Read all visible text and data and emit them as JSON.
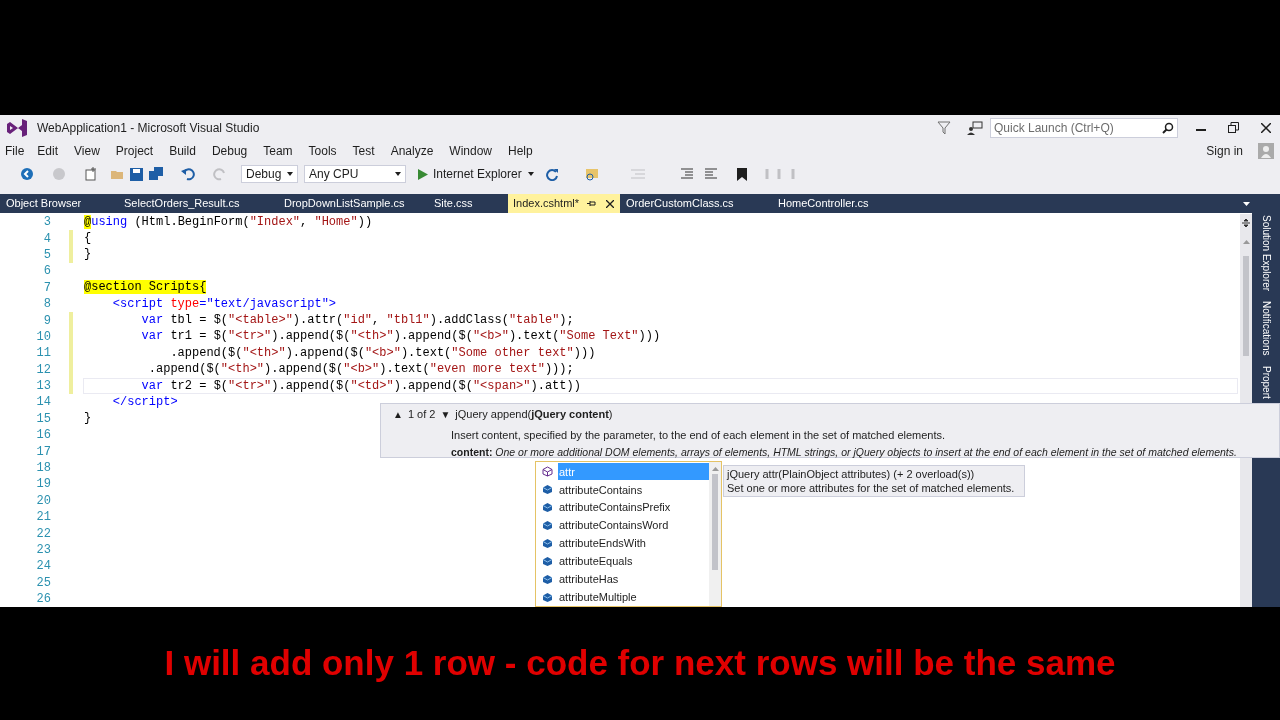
{
  "window": {
    "title": "WebApplication1 - Microsoft Visual Studio"
  },
  "quick_launch": {
    "placeholder": "Quick Launch (Ctrl+Q)"
  },
  "menu": [
    "File",
    "Edit",
    "View",
    "Project",
    "Build",
    "Debug",
    "Team",
    "Tools",
    "Test",
    "Analyze",
    "Window",
    "Help"
  ],
  "sign_in": "Sign in",
  "toolbar": {
    "configuration": "Debug",
    "platform": "Any CPU",
    "run_target": "Internet Explorer"
  },
  "tabs": [
    {
      "label": "Object Browser",
      "selected": false
    },
    {
      "label": "SelectOrders_Result.cs",
      "selected": false
    },
    {
      "label": "DropDownListSample.cs",
      "selected": false
    },
    {
      "label": "Site.css",
      "selected": false
    },
    {
      "label": "Index.cshtml*",
      "selected": true
    },
    {
      "label": "OrderCustomClass.cs",
      "selected": false
    },
    {
      "label": "HomeController.cs",
      "selected": false
    }
  ],
  "side_panels": [
    "Solution Explorer",
    "Notifications",
    "Propert"
  ],
  "code_lines": [
    {
      "number": "3",
      "changed": false,
      "current": false,
      "tokens": [
        {
          "kind": "razor",
          "text": "@"
        },
        {
          "kind": "keyword",
          "text": "using"
        },
        {
          "kind": "plain",
          "text": " (Html.BeginForm("
        },
        {
          "kind": "string",
          "text": "\"Index\""
        },
        {
          "kind": "plain",
          "text": ", "
        },
        {
          "kind": "string",
          "text": "\"Home\""
        },
        {
          "kind": "plain",
          "text": "))"
        }
      ]
    },
    {
      "number": "4",
      "changed": true,
      "current": false,
      "tokens": [
        {
          "kind": "plain",
          "text": "{"
        }
      ]
    },
    {
      "number": "5",
      "changed": true,
      "current": false,
      "tokens": [
        {
          "kind": "plain",
          "text": "}"
        }
      ]
    },
    {
      "number": "6",
      "changed": false,
      "current": false
    },
    {
      "number": "7",
      "changed": false,
      "current": false,
      "tokens": [
        {
          "kind": "razor",
          "text": "@section Scripts{"
        }
      ]
    },
    {
      "number": "8",
      "changed": false,
      "current": false,
      "tokens": [
        {
          "kind": "tag",
          "text": "    <script"
        },
        {
          "kind": "attribute",
          "text": " type"
        },
        {
          "kind": "tag",
          "text": "=\"text/javascript\">"
        }
      ]
    },
    {
      "number": "9",
      "changed": true,
      "current": false,
      "tokens": [
        {
          "kind": "keyword",
          "text": "        var"
        },
        {
          "kind": "plain",
          "text": " tbl = $("
        },
        {
          "kind": "string",
          "text": "\"<table>\""
        },
        {
          "kind": "plain",
          "text": ").attr("
        },
        {
          "kind": "string",
          "text": "\"id\""
        },
        {
          "kind": "plain",
          "text": ", "
        },
        {
          "kind": "string",
          "text": "\"tbl1\""
        },
        {
          "kind": "plain",
          "text": ").addClass("
        },
        {
          "kind": "string",
          "text": "\"table\""
        },
        {
          "kind": "plain",
          "text": ");"
        }
      ]
    },
    {
      "number": "10",
      "changed": true,
      "current": false,
      "tokens": [
        {
          "kind": "keyword",
          "text": "        var"
        },
        {
          "kind": "plain",
          "text": " tr1 = $("
        },
        {
          "kind": "string",
          "text": "\"<tr>\""
        },
        {
          "kind": "plain",
          "text": ").append($("
        },
        {
          "kind": "string",
          "text": "\"<th>\""
        },
        {
          "kind": "plain",
          "text": ").append($("
        },
        {
          "kind": "string",
          "text": "\"<b>\""
        },
        {
          "kind": "plain",
          "text": ").text("
        },
        {
          "kind": "string",
          "text": "\"Some Text\""
        },
        {
          "kind": "plain",
          "text": ")))"
        }
      ]
    },
    {
      "number": "11",
      "changed": true,
      "current": false,
      "tokens": [
        {
          "kind": "plain",
          "text": "            .append($("
        },
        {
          "kind": "string",
          "text": "\"<th>\""
        },
        {
          "kind": "plain",
          "text": ").append($("
        },
        {
          "kind": "string",
          "text": "\"<b>\""
        },
        {
          "kind": "plain",
          "text": ").text("
        },
        {
          "kind": "string",
          "text": "\"Some other text\""
        },
        {
          "kind": "plain",
          "text": ")))"
        }
      ]
    },
    {
      "number": "12",
      "changed": true,
      "current": false,
      "tokens": [
        {
          "kind": "plain",
          "text": "         .append($("
        },
        {
          "kind": "string",
          "text": "\"<th>\""
        },
        {
          "kind": "plain",
          "text": ").append($("
        },
        {
          "kind": "string",
          "text": "\"<b>\""
        },
        {
          "kind": "plain",
          "text": ").text("
        },
        {
          "kind": "string",
          "text": "\"even more text\""
        },
        {
          "kind": "plain",
          "text": ")));"
        }
      ]
    },
    {
      "number": "13",
      "changed": true,
      "current": true,
      "tokens": [
        {
          "kind": "keyword",
          "text": "        var"
        },
        {
          "kind": "plain",
          "text": " tr2 = $("
        },
        {
          "kind": "string",
          "text": "\"<tr>\""
        },
        {
          "kind": "plain",
          "text": ").append($("
        },
        {
          "kind": "string",
          "text": "\"<td>\""
        },
        {
          "kind": "plain",
          "text": ").append($("
        },
        {
          "kind": "string",
          "text": "\"<span>\""
        },
        {
          "kind": "plain",
          "text": ").att))"
        }
      ]
    },
    {
      "number": "14",
      "changed": false,
      "current": false,
      "tokens": [
        {
          "kind": "tag",
          "text": "    </script>"
        }
      ]
    },
    {
      "number": "15",
      "changed": false,
      "current": false,
      "tokens": [
        {
          "kind": "plain",
          "text": "}"
        }
      ]
    },
    {
      "number": "16",
      "changed": false,
      "current": false
    },
    {
      "number": "17",
      "changed": false,
      "current": false
    },
    {
      "number": "18",
      "changed": false,
      "current": false
    },
    {
      "number": "19",
      "changed": false,
      "current": false
    },
    {
      "number": "20",
      "changed": false,
      "current": false
    },
    {
      "number": "21",
      "changed": false,
      "current": false
    },
    {
      "number": "22",
      "changed": false,
      "current": false
    },
    {
      "number": "23",
      "changed": false,
      "current": false
    },
    {
      "number": "24",
      "changed": false,
      "current": false
    },
    {
      "number": "25",
      "changed": false,
      "current": false
    },
    {
      "number": "26",
      "changed": false,
      "current": false
    }
  ],
  "signature_help": {
    "up": "▲",
    "counter": "1 of 2",
    "down": "▼",
    "signature": "jQuery append(**jQuery content**)",
    "description": "Insert content, specified by the parameter, to the end of each element in the set of matched elements.",
    "parameter": "**content:** *One or more additional DOM elements, arrays of elements, HTML strings, or jQuery objects to insert at the end of each element in the set of matched elements.*"
  },
  "completion": {
    "items": [
      {
        "label": "attr",
        "kind": "method",
        "selected": true
      },
      {
        "label": "attributeContains",
        "kind": "selector",
        "selected": false
      },
      {
        "label": "attributeContainsPrefix",
        "kind": "selector",
        "selected": false
      },
      {
        "label": "attributeContainsWord",
        "kind": "selector",
        "selected": false
      },
      {
        "label": "attributeEndsWith",
        "kind": "selector",
        "selected": false
      },
      {
        "label": "attributeEquals",
        "kind": "selector",
        "selected": false
      },
      {
        "label": "attributeHas",
        "kind": "selector",
        "selected": false
      },
      {
        "label": "attributeMultiple",
        "kind": "selector",
        "selected": false
      }
    ],
    "tooltip": [
      "jQuery attr(PlainObject attributes) (+ 2 overload(s))",
      "Set one or more attributes for the set of matched elements."
    ]
  },
  "subtitle": "I will add only 1 row - code for next rows will be the same"
}
